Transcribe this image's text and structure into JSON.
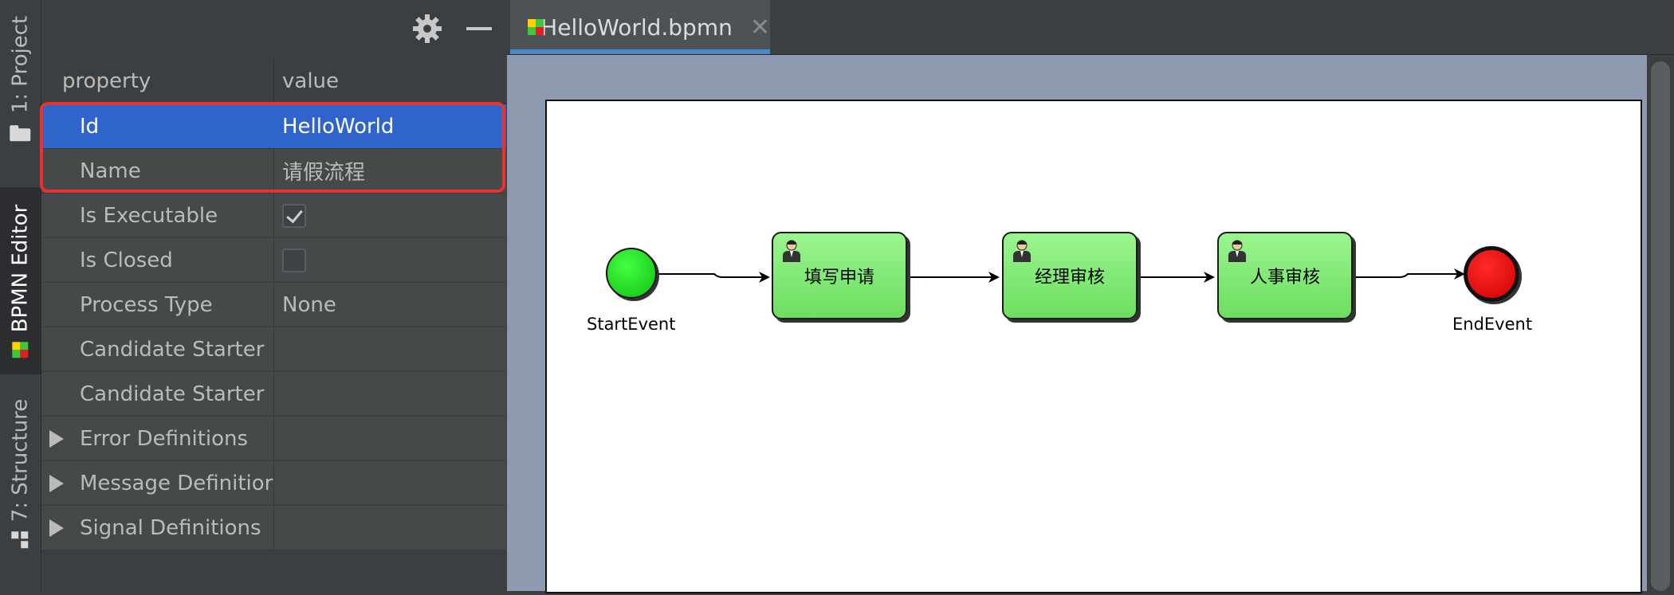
{
  "left_strip": {
    "tabs": [
      {
        "label": "1: Project",
        "icon": "folder-icon"
      },
      {
        "label": "BPMN Editor",
        "icon": "bpmn-icon"
      },
      {
        "label": "7: Structure",
        "icon": "structure-icon"
      }
    ]
  },
  "properties": {
    "headers": {
      "property": "property",
      "value": "value"
    },
    "rows": [
      {
        "name": "Id",
        "value": "HelloWorld"
      },
      {
        "name": "Name",
        "value": "请假流程"
      },
      {
        "name": "Is Executable",
        "value": ""
      },
      {
        "name": "Is Closed",
        "value": ""
      },
      {
        "name": "Process Type",
        "value": "None"
      },
      {
        "name": "Candidate Starter",
        "value": ""
      },
      {
        "name": "Candidate Starter",
        "value": ""
      },
      {
        "name": "Error Definitions",
        "value": ""
      },
      {
        "name": "Message Definitior",
        "value": ""
      },
      {
        "name": "Signal Definitions",
        "value": ""
      }
    ],
    "is_executable_checked": true,
    "is_closed_checked": false
  },
  "editor": {
    "tab_label": "HelloWorld.bpmn",
    "close_glyph": "✕",
    "diagram": {
      "start_label": "StartEvent",
      "end_label": "EndEvent",
      "tasks": [
        "填写申请",
        "经理审核",
        "人事审核"
      ]
    }
  },
  "colors": {
    "selection": "#2f65ca",
    "highlight_box": "#e8322d",
    "task_fill": "#86ee7a",
    "start_fill": "#22e022",
    "end_fill": "#ee0000"
  }
}
